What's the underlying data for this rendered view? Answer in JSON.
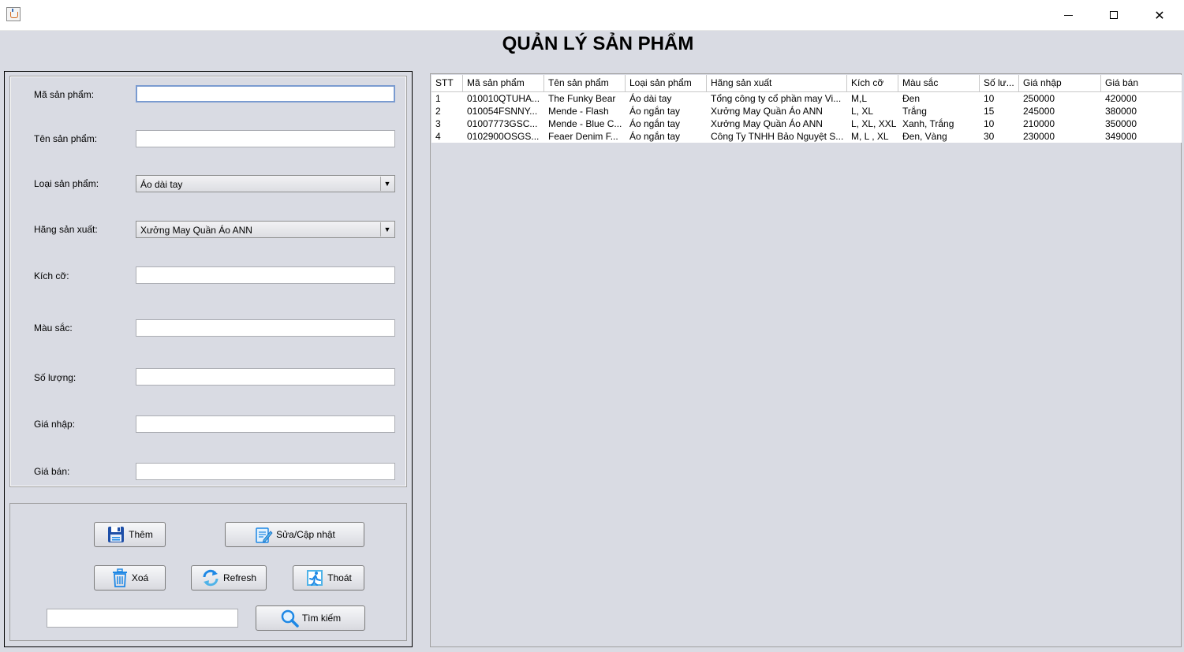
{
  "title": "QUẢN LÝ SẢN PHẨM",
  "window": {
    "close_glyph": "✕"
  },
  "form": {
    "labels": {
      "ma": "Mã sản phẩm:",
      "ten": "Tên sản phẩm:",
      "loai": "Loại sản phẩm:",
      "hang": "Hãng sản xuất:",
      "kichco": "Kích cỡ:",
      "mausac": "Màu sắc:",
      "soluong": "Số lượng:",
      "gianhap": "Giá nhập:",
      "giaban": "Giá bán:"
    },
    "values": {
      "ma": "",
      "ten": "",
      "kichco": "",
      "mausac": "",
      "soluong": "",
      "gianhap": "",
      "giaban": ""
    },
    "loai_selected": "Áo dài tay",
    "hang_selected": "Xưởng May Quần Áo ANN"
  },
  "buttons": {
    "them": "Thêm",
    "sua": "Sửa/Cập nhật",
    "xoa": "Xoá",
    "refresh": "Refresh",
    "thoat": "Thoát",
    "timkiem": "Tìm kiếm"
  },
  "search": {
    "value": ""
  },
  "icons": {
    "save": "floppy-disk-icon",
    "edit": "edit-notepad-icon",
    "delete": "trash-icon",
    "refresh": "refresh-arrows-icon",
    "exit": "exit-door-icon",
    "search": "magnifier-icon"
  },
  "colors": {
    "icon_blue": "#1e88e5",
    "icon_light": "#4fb3e8"
  },
  "table": {
    "headers": [
      "STT",
      "Mã sản phẩm",
      "Tên sản phẩm",
      "Loại sản phẩm",
      "Hãng sản xuất",
      "Kích cỡ",
      "Màu sắc",
      "Số lư...",
      "Giá nhập",
      "Giá bán"
    ],
    "rows": [
      [
        "1",
        "010010QTUHA...",
        "The Funky Bear",
        "Áo dài tay",
        "Tổng công ty cổ phần may Vi...",
        "M,L",
        "Đen",
        "10",
        "250000",
        "420000"
      ],
      [
        "2",
        "010054FSNNY...",
        "Mende - Flash",
        "Áo ngắn tay",
        "Xưởng May Quần Áo ANN",
        "L, XL",
        "Trắng",
        "15",
        "245000",
        "380000"
      ],
      [
        "3",
        "01007773GSC...",
        "Mende - Blue C...",
        "Áo ngắn tay",
        "Xưởng May Quần Áo ANN",
        "L, XL, XXL",
        "Xanh, Trắng",
        "10",
        "210000",
        "350000"
      ],
      [
        "4",
        "0102900OSGS...",
        "Feaer Denim F...",
        "Áo ngắn tay",
        "Công Ty TNHH Bảo Nguyệt S...",
        "M, L , XL",
        "Đen, Vàng",
        "30",
        "230000",
        "349000"
      ]
    ]
  }
}
